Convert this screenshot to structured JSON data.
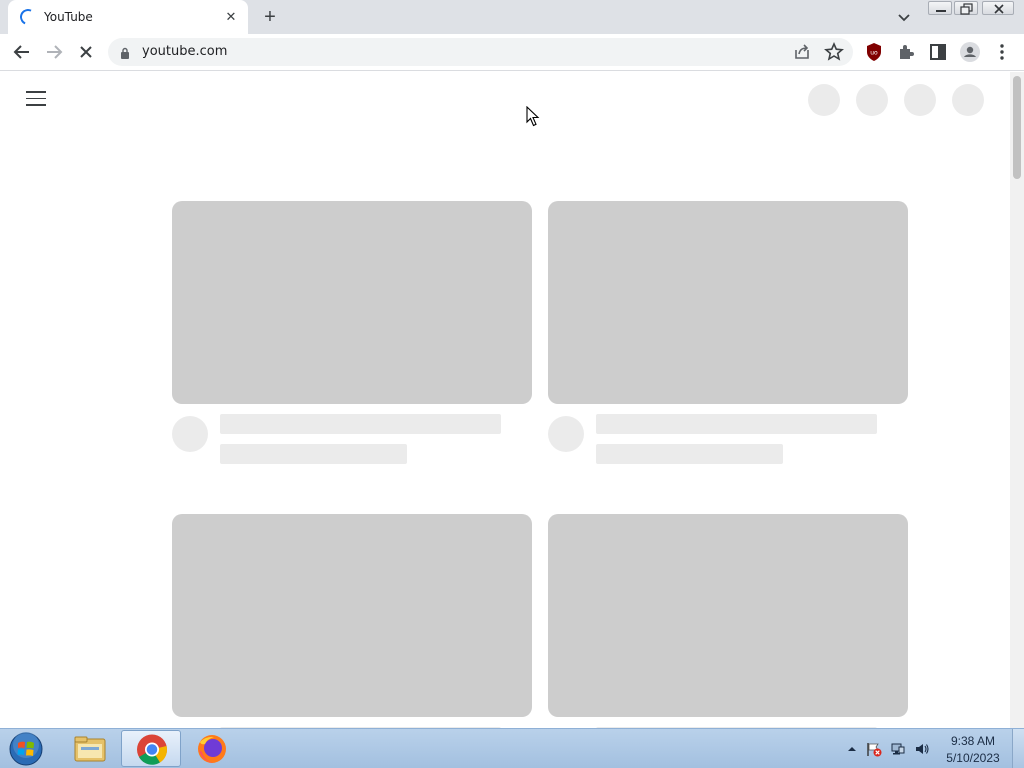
{
  "browser": {
    "tab": {
      "title": "YouTube",
      "close_glyph": "✕"
    },
    "new_tab_glyph": "+",
    "address": {
      "url": "youtube.com"
    },
    "icons": [
      "back-icon",
      "forward-icon",
      "stop-loading-icon",
      "lock-icon",
      "share-icon",
      "bookmark-star-icon",
      "ublock-icon",
      "extensions-icon",
      "side-panel-icon",
      "profile-icon",
      "menu-icon"
    ]
  },
  "page": {
    "state": "loading-skeleton",
    "video_cards": 4
  },
  "taskbar": {
    "apps": [
      "windows-explorer",
      "google-chrome",
      "firefox"
    ],
    "clock": {
      "time": "9:38 AM",
      "date": "5/10/2023"
    }
  },
  "colors": {
    "tab_strip": "#dee1e6",
    "skeleton_thumb": "#cdcdcd",
    "skeleton_line": "#ebebeb",
    "accent": "#1a73e8",
    "ublock": "#800000"
  }
}
